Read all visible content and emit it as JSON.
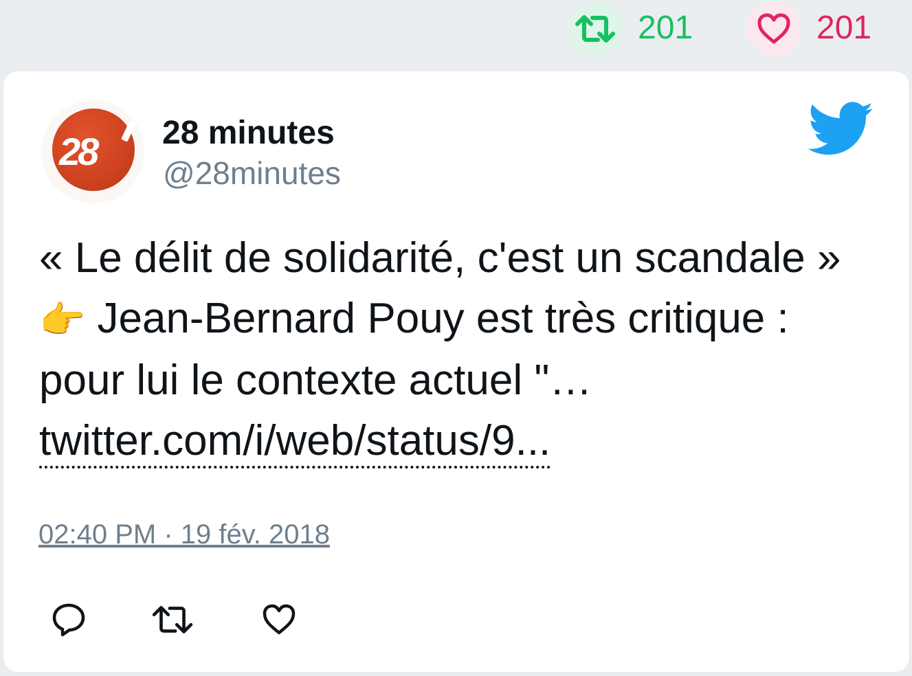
{
  "stats": {
    "retweet_count": "201",
    "like_count": "201"
  },
  "author": {
    "avatar_text": "28",
    "display_name": "28 minutes",
    "handle": "@28minutes"
  },
  "tweet": {
    "text_part1": "« Le délit de solidarité, c'est un scandale » ",
    "emoji": "👉",
    "text_part2": " Jean-Bernard Pouy est très critique : pour lui le contexte actuel \"… ",
    "link": "twitter.com/i/web/status/9...",
    "timestamp": "02:40 PM · 19 fév. 2018"
  },
  "colors": {
    "background": "#ebeef1",
    "retweet_green": "#17bf63",
    "like_red": "#e0245e",
    "twitter_blue": "#1da1f2",
    "text_primary": "#0f1419",
    "text_secondary": "#6e7f8d"
  },
  "icons": {
    "retweet": "retweet-icon",
    "like": "heart-icon",
    "brand": "twitter-bird-icon",
    "reply": "reply-icon"
  }
}
